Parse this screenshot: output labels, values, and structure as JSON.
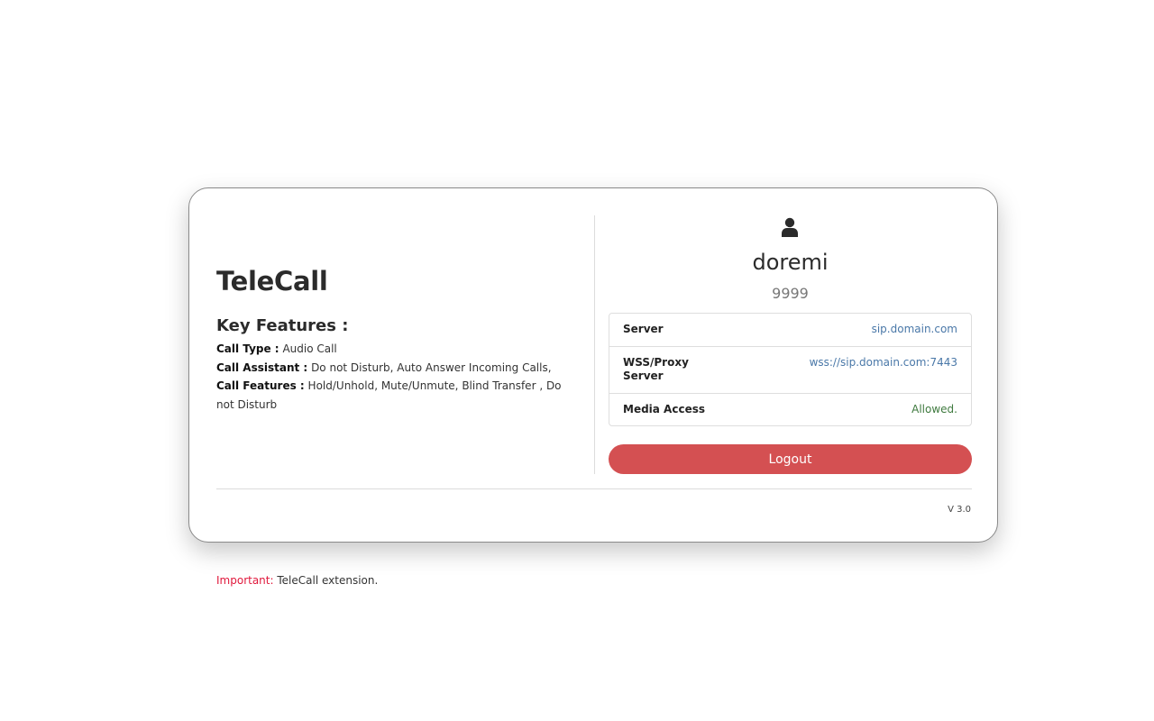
{
  "app": {
    "title": "TeleCall"
  },
  "features": {
    "title": "Key Features :",
    "items": [
      {
        "label": "Call Type :",
        "value": "Audio Call"
      },
      {
        "label": "Call Assistant :",
        "value": "Do not Disturb, Auto Answer Incoming Calls,"
      },
      {
        "label": "Call Features :",
        "value": "Hold/Unhold, Mute/Unmute, Blind Transfer , Do not Disturb"
      }
    ]
  },
  "user": {
    "icon": "user-icon",
    "name": "doremi",
    "extension": "9999"
  },
  "info": {
    "rows": [
      {
        "key": "Server",
        "value": "sip.domain.com"
      },
      {
        "key": "WSS/Proxy Server",
        "value": "wss://sip.domain.com:7443"
      },
      {
        "key": "Media Access",
        "value": "Allowed."
      }
    ]
  },
  "actions": {
    "logout_label": "Logout"
  },
  "footer": {
    "version": "V 3.0"
  },
  "note": {
    "label": "Important:",
    "text": "TeleCall extension."
  },
  "colors": {
    "logout_button": "#d45052",
    "link": "#4a78a8",
    "allowed": "#3f7a3f",
    "important": "#e0183c"
  }
}
